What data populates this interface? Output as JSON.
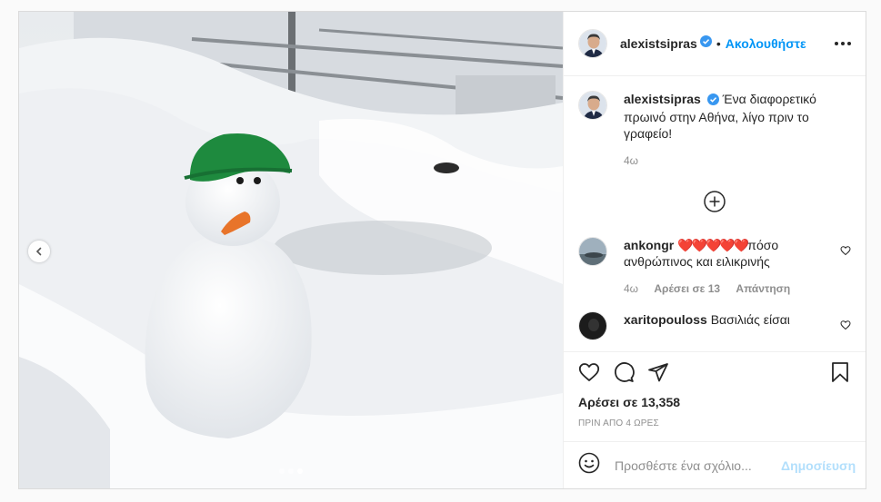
{
  "header": {
    "username": "alexistsipras",
    "separator": "•",
    "follow_label": "Ακολουθήστε"
  },
  "caption": {
    "username": "alexistsipras",
    "text": "Ένα διαφορετικό πρωινό στην Αθήνα, λίγο πριν το γραφείο!",
    "time": "4ω"
  },
  "comments": [
    {
      "username": "ankongr",
      "hearts": "❤️❤️❤️❤️❤️",
      "text": "πόσο ανθρώπινος και ειλικρινής",
      "time": "4ω",
      "likes": "Αρέσει σε 13",
      "reply": "Απάντηση"
    },
    {
      "username": "xaritopouloss",
      "text": "Βασιλιάς είσαι"
    }
  ],
  "likes_text": "Αρέσει σε 13,358",
  "timestamp": "ΠΡΙΝ ΑΠΟ 4 ΩΡΕΣ",
  "add_comment": {
    "placeholder": "Προσθέστε ένα σχόλιο...",
    "post_label": "Δημοσίευση"
  },
  "carousel": {
    "slides": 3,
    "active": 3
  },
  "colors": {
    "accent": "#0095f6",
    "post_disabled": "#b2dffc",
    "verified": "#3897f0",
    "hat": "#1e8a3e",
    "nose": "#e8742a"
  },
  "icons": [
    "verified-icon",
    "more-options-icon",
    "load-more-comments-icon",
    "heart-icon",
    "comment-icon",
    "share-icon",
    "save-icon",
    "emoji-icon",
    "chevron-left-icon"
  ]
}
